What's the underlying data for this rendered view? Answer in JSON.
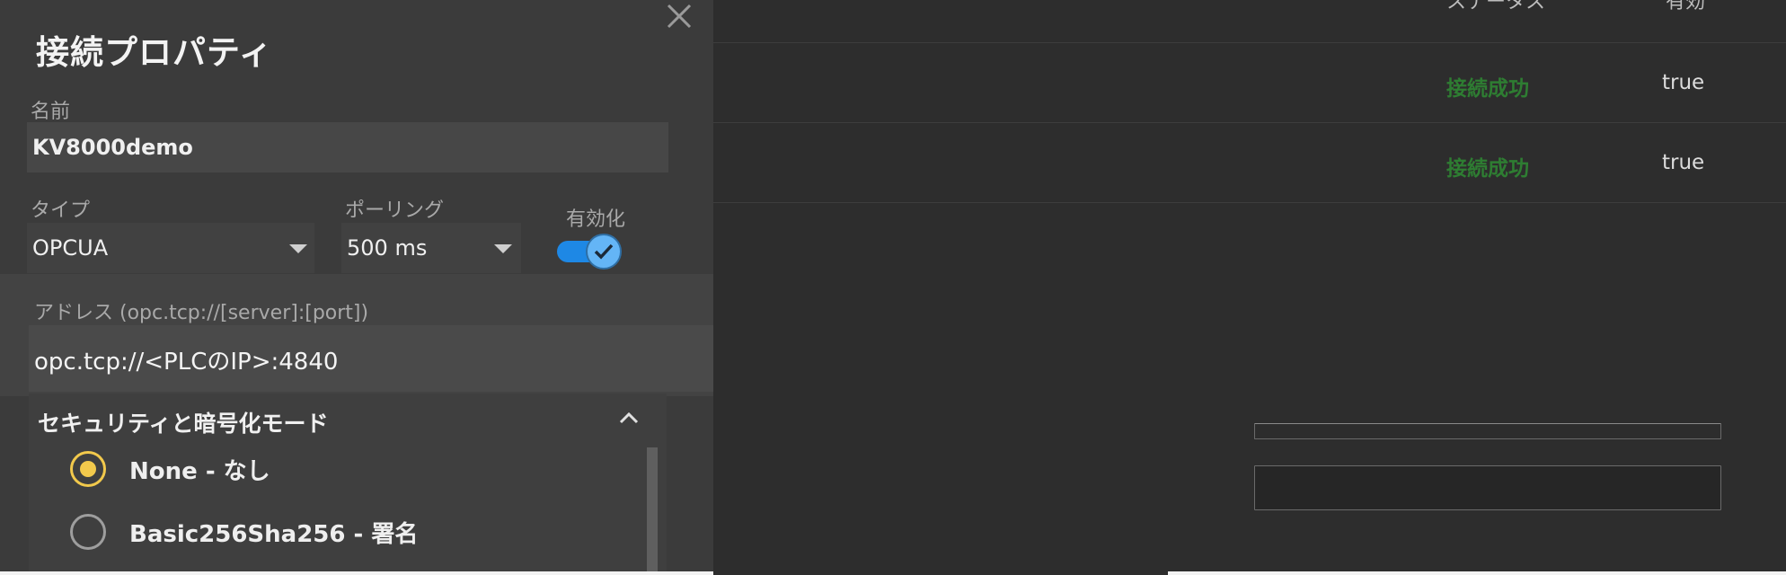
{
  "background": {
    "columns": [
      "ステータス",
      "有効"
    ],
    "rows": [
      {
        "status": "接続成功",
        "enabled": "true"
      },
      {
        "status": "接続成功",
        "enabled": "true"
      }
    ],
    "status_color": "#2e7d32"
  },
  "dialog": {
    "title": "接続プロパティ",
    "close_icon": "close-icon",
    "name": {
      "label": "名前",
      "value": "KV8000demo"
    },
    "type": {
      "label": "タイプ",
      "value": "OPCUA"
    },
    "polling": {
      "label": "ポーリング",
      "value": "500 ms"
    },
    "enabled": {
      "label": "有効化",
      "checked": true,
      "accent": "#1e88e5"
    },
    "address": {
      "label": "アドレス (opc.tcp://[server]:[port])",
      "value": "opc.tcp://<PLCのIP>:4840"
    },
    "security": {
      "title": "セキュリティと暗号化モード",
      "expanded": true,
      "options": [
        {
          "label": "None - なし",
          "selected": true
        },
        {
          "label": "Basic256Sha256 - 署名",
          "selected": false
        }
      ],
      "accent": "#f2c94c"
    }
  }
}
